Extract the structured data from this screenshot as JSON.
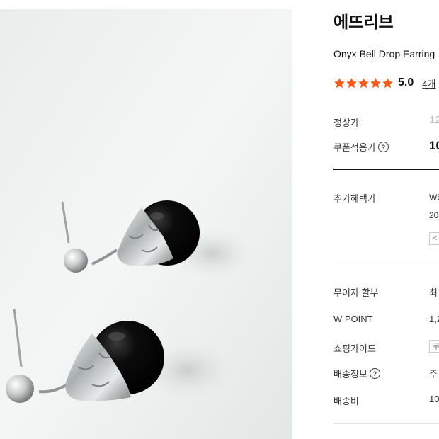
{
  "colors": {
    "star": "#f25c1e",
    "accent_dark": "#111111"
  },
  "product": {
    "brand": "에뜨리브",
    "name": "Onyx Bell Drop Earring",
    "rating": 5.0,
    "rating_text": "5.0",
    "reviews_text": "4개",
    "stars_count": 5
  },
  "price": {
    "regular_label": "정상가",
    "regular_value": "12",
    "coupon_label": "쿠폰적용가",
    "coupon_value": "10"
  },
  "benefits": {
    "extra_label": "추가혜택가",
    "extra_line1": "W카",
    "extra_line2": "20",
    "extra_button": "<"
  },
  "details": {
    "installment_label": "무이자 할부",
    "installment_value": "최",
    "wpoint_label": "W POINT",
    "wpoint_value": "1,2",
    "guide_label": "쇼핑가이드",
    "guide_button": "쿠",
    "shipping_info_label": "배송정보",
    "shipping_info_value": "주",
    "shipping_fee_label": "배송비",
    "shipping_fee_value": "10"
  },
  "icons": {
    "help": "question-circle-icon",
    "star": "star-icon"
  }
}
